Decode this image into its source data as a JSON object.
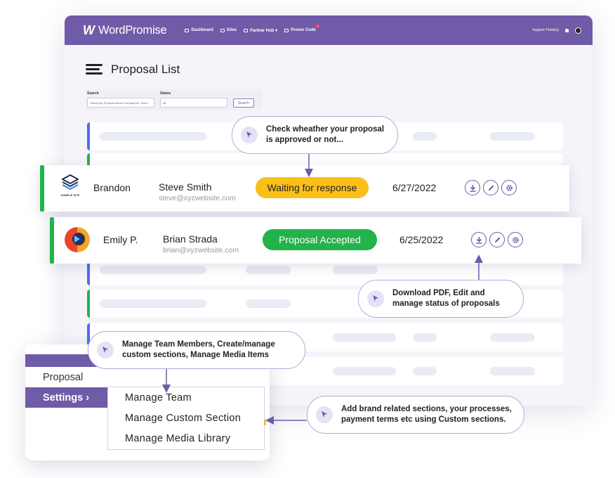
{
  "app": {
    "brand": "WordPromise",
    "nav": [
      {
        "label": "Dashboard",
        "icon": "dashboard-icon"
      },
      {
        "label": "Sites",
        "icon": "sites-icon"
      },
      {
        "label": "Partner Hub ▾",
        "icon": "partner-hub-icon"
      },
      {
        "label": "Promo Code",
        "icon": "tag-icon"
      }
    ],
    "support": "Support Ticket(s)",
    "page_title": "Proposal List",
    "filters": {
      "search_label": "Search",
      "search_placeholder": "Search By Proposal Name,Proposal No, Client",
      "status_label": "Status",
      "status_value": "All",
      "search_button": "Search"
    }
  },
  "proposals": [
    {
      "client": "Brandon",
      "contact_name": "Steve Smith",
      "contact_email": "steve@xyzwebsite.com",
      "status": "Waiting for response",
      "status_color": "#fbbf1a",
      "date": "6/27/2022",
      "logo": "sample-site-logo",
      "logo_caption": "SAMPLE SITE"
    },
    {
      "client": "Emily P.",
      "contact_name": "Brian Strada",
      "contact_email": "brian@xyzwebsite.com",
      "status": "Proposal Accepted",
      "status_color": "#22b34a",
      "date": "6/25/2022",
      "logo": "avatar-logo"
    }
  ],
  "callouts": {
    "status": "Check wheather your proposal is approved or not...",
    "actions": "Download PDF, Edit and manage status of proposals",
    "settings": "Manage Team Members, Create/manage custom sections, Manage Media Items",
    "sections": "Add brand related sections, your processes, payment terms etc using Custom sections."
  },
  "side_menu": {
    "items": [
      "Proposal",
      "Settings ›"
    ],
    "submenu": [
      "Manage Team",
      "Manage Custom Section",
      "Manage Media Library"
    ]
  },
  "colors": {
    "brand": "#6f5ba7",
    "accepted": "#22b34a",
    "waiting": "#fbbf1a",
    "placeholder_edge_blue": "#4c6ef5"
  }
}
